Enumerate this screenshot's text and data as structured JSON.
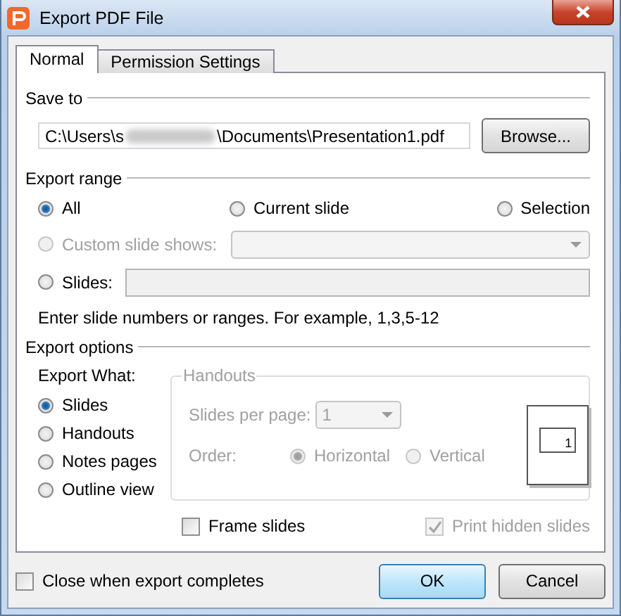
{
  "window": {
    "title": "Export PDF File"
  },
  "tabs": [
    {
      "label": "Normal",
      "selected": true
    },
    {
      "label": "Permission Settings",
      "selected": false
    }
  ],
  "save_to": {
    "heading": "Save to",
    "path_start": "C:\\Users\\s",
    "path_end": "\\Documents\\Presentation1.pdf",
    "browse": {
      "label": "Browse..."
    }
  },
  "export_range": {
    "heading": "Export range",
    "options": [
      {
        "label": "All",
        "selected": true
      },
      {
        "label": "Current slide",
        "selected": false
      },
      {
        "label": "Selection",
        "selected": false
      }
    ],
    "custom_shows": {
      "label": "Custom slide shows:",
      "selected": false,
      "disabled": true
    },
    "slides": {
      "label": "Slides:",
      "selected": false,
      "disabled": false
    },
    "hint": "Enter slide numbers or ranges. For example, 1,3,5-12"
  },
  "export_options": {
    "heading": "Export options",
    "what_label": "Export What:",
    "what": [
      {
        "label": "Slides",
        "selected": true
      },
      {
        "label": "Handouts",
        "selected": false
      },
      {
        "label": "Notes pages",
        "selected": false
      },
      {
        "label": "Outline view",
        "selected": false
      }
    ],
    "handouts": {
      "heading": "Handouts",
      "disabled": true,
      "per_page_label": "Slides per page:",
      "per_page_value": "1",
      "order_label": "Order:",
      "orders": [
        {
          "label": "Horizontal",
          "selected": true
        },
        {
          "label": "Vertical",
          "selected": false
        }
      ],
      "preview_number": "1"
    },
    "frame_slides": {
      "label": "Frame slides",
      "checked": false,
      "disabled": false
    },
    "print_hidden": {
      "label": "Print hidden slides",
      "checked": true,
      "disabled": true
    }
  },
  "close_when_done": {
    "label": "Close when export completes",
    "checked": false
  },
  "buttons": [
    {
      "label": "OK",
      "default": true
    },
    {
      "label": "Cancel",
      "default": false
    }
  ]
}
